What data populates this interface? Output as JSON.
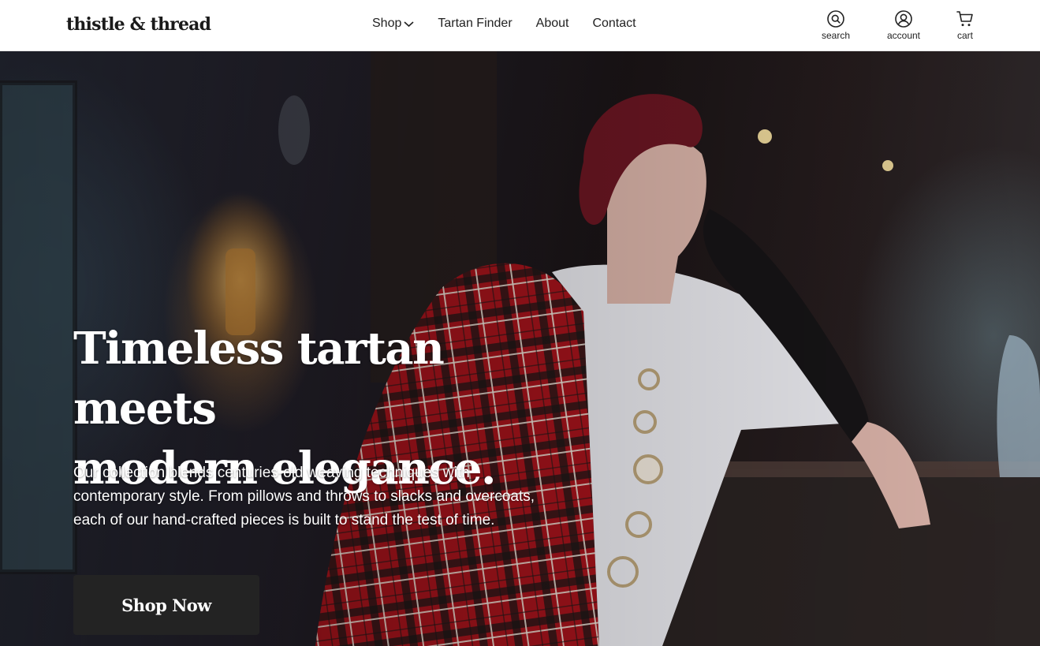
{
  "brand": {
    "logo_text": "thistle & thread"
  },
  "nav": {
    "items": [
      {
        "label": "Shop",
        "has_dropdown": true
      },
      {
        "label": "Tartan Finder"
      },
      {
        "label": "About"
      },
      {
        "label": "Contact"
      }
    ]
  },
  "utilities": {
    "search": {
      "label": "search",
      "icon": "search-icon"
    },
    "account": {
      "label": "account",
      "icon": "account-icon"
    },
    "cart": {
      "label": "cart",
      "icon": "cart-icon"
    }
  },
  "hero": {
    "headline_line1": "Timeless tartan meets",
    "headline_line2": "modern elegance.",
    "tagline": "Our collection blends centuries-old weaving techniques with contemporary style. From pillows and throws to slacks and overcoats, each of our hand-crafted pieces is built to stand the test of time.",
    "cta_label": "Shop Now",
    "image_alt": "Woman in red tartan coat and black gloves in a dimly lit room"
  },
  "colors": {
    "header_bg": "#ffffff",
    "text_dark": "#222222",
    "cta_bg": "#232323",
    "hero_text": "#ffffff",
    "tartan_red": "#b5121b"
  }
}
